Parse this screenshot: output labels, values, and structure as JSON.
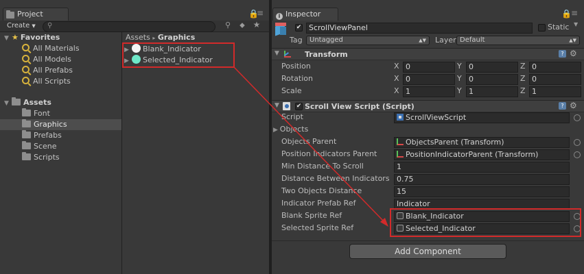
{
  "project_panel": {
    "tab_title": "Project",
    "create_label": "Create",
    "search_placeholder": "",
    "favorites": {
      "label": "Favorites",
      "items": [
        "All Materials",
        "All Models",
        "All Prefabs",
        "All Scripts"
      ]
    },
    "assets": {
      "label": "Assets",
      "items": [
        "Font",
        "Graphics",
        "Prefabs",
        "Scene",
        "Scripts"
      ],
      "selected": "Graphics"
    },
    "breadcrumb": {
      "root": "Assets",
      "separator": "▸",
      "current": "Graphics"
    },
    "files": [
      {
        "name": "Blank_Indicator",
        "color": "#f4f4f4"
      },
      {
        "name": "Selected_Indicator",
        "color": "#6ee7c8"
      }
    ]
  },
  "inspector": {
    "tab_title": "Inspector",
    "object_name": "ScrollViewPanel",
    "static_label": "Static",
    "tag_label": "Tag",
    "tag_value": "Untagged",
    "layer_label": "Layer",
    "layer_value": "Default",
    "transform": {
      "title": "Transform",
      "rows": [
        {
          "label": "Position",
          "x": "0",
          "y": "0",
          "z": "0"
        },
        {
          "label": "Rotation",
          "x": "0",
          "y": "0",
          "z": "0"
        },
        {
          "label": "Scale",
          "x": "1",
          "y": "1",
          "z": "1"
        }
      ],
      "axis_x": "X",
      "axis_y": "Y",
      "axis_z": "Z"
    },
    "script_component": {
      "title": "Scroll View Script (Script)",
      "rows": [
        {
          "label": "Script",
          "value": "ScrollViewScript",
          "kind": "object",
          "icon": "script-icon"
        },
        {
          "label": "Objects",
          "value": "",
          "kind": "foldout"
        },
        {
          "label": "Objects Parent",
          "value": "ObjectsParent (Transform)",
          "kind": "object",
          "icon": "transform-icon"
        },
        {
          "label": "Position Indicators Parent",
          "value": "PositionIndicatorParent (Transform)",
          "kind": "object",
          "icon": "transform-icon"
        },
        {
          "label": "Min Distance To Scroll",
          "value": "1",
          "kind": "number"
        },
        {
          "label": "Distance Between Indicators",
          "value": "0.75",
          "kind": "number"
        },
        {
          "label": "Two Objects Distance",
          "value": "15",
          "kind": "number"
        },
        {
          "label": "Indicator Prefab Ref",
          "value": "Indicator",
          "kind": "number"
        },
        {
          "label": "Blank Sprite Ref",
          "value": "Blank_Indicator",
          "kind": "object",
          "icon": "sprite-icon"
        },
        {
          "label": "Selected Sprite Ref",
          "value": "Selected_Indicator",
          "kind": "object",
          "icon": "sprite-icon"
        }
      ]
    },
    "add_component_label": "Add Component"
  },
  "colors": {
    "highlight_box": "#d32a2a",
    "arrow": "#d32a2a",
    "panel_bg": "#393939"
  }
}
